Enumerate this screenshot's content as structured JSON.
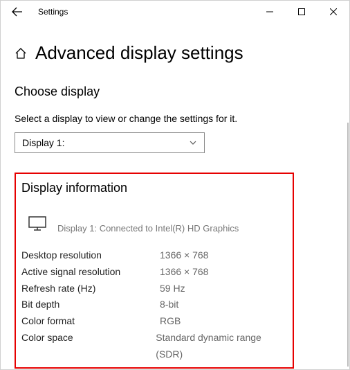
{
  "titleBar": {
    "title": "Settings"
  },
  "page": {
    "title": "Advanced display settings"
  },
  "chooseDisplay": {
    "heading": "Choose display",
    "description": "Select a display to view or change the settings for it.",
    "selected": "Display 1:"
  },
  "info": {
    "heading": "Display information",
    "connected": "Display 1: Connected to Intel(R) HD Graphics",
    "rows": [
      {
        "key": "Desktop resolution",
        "val": "1366 × 768"
      },
      {
        "key": "Active signal resolution",
        "val": "1366 × 768"
      },
      {
        "key": "Refresh rate (Hz)",
        "val": "59 Hz"
      },
      {
        "key": "Bit depth",
        "val": "8-bit"
      },
      {
        "key": "Color format",
        "val": "RGB"
      },
      {
        "key": "Color space",
        "val": "Standard dynamic range (SDR)"
      }
    ]
  }
}
